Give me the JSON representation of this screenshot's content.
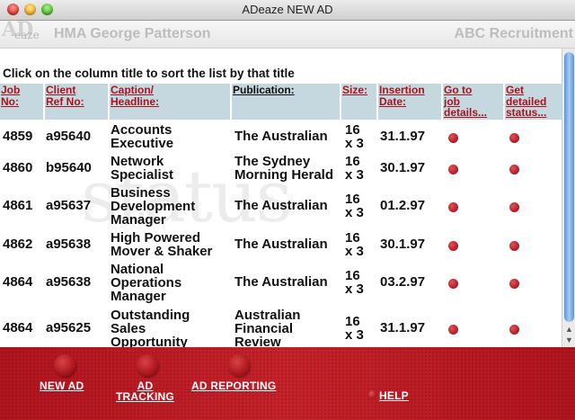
{
  "window": {
    "title": "ADeaze NEW AD"
  },
  "banner": {
    "logo_ad": "AD",
    "logo_rest": "eaze",
    "agency": "HMA George Patterson",
    "company": "ABC Recruitment"
  },
  "watermark": "status",
  "instruction": "Click on the column title to sort the list by that title",
  "columns": {
    "job_no": "Job\nNo:",
    "client_ref": "Client\nRef No:",
    "caption": "Caption/\nHeadline:",
    "publication": "Publication:",
    "size": "Size:",
    "insertion": "Insertion\nDate:",
    "goto": "Go to\njob\ndetails...",
    "status": "Get\ndetailed\nstatus..."
  },
  "rows": [
    {
      "job": "4859",
      "ref": "a95640",
      "caption": "Accounts\nExecutive",
      "pub": "The Australian",
      "size": "16\nx 3",
      "date": "31.1.97"
    },
    {
      "job": "4860",
      "ref": "b95640",
      "caption": "Network\nSpecialist",
      "pub": "The Sydney\nMorning Herald",
      "size": "16\nx 3",
      "date": "30.1.97"
    },
    {
      "job": "4861",
      "ref": "a95637",
      "caption": "Business\nDevelopment\nManager",
      "pub": "The Australian",
      "size": "16\nx 3",
      "date": "01.2.97"
    },
    {
      "job": "4862",
      "ref": "a95638",
      "caption": "High Powered\nMover & Shaker",
      "pub": "The Australian",
      "size": "16\nx 3",
      "date": "30.1.97"
    },
    {
      "job": "4864",
      "ref": "a95638",
      "caption": "National\nOperations\nManager",
      "pub": "The Australian",
      "size": "16\nx 3",
      "date": "03.2.97"
    },
    {
      "job": "4864",
      "ref": "a95625",
      "caption": "Outstanding\nSales\nOpportunity",
      "pub": "Australian\nFinancial\nReview",
      "size": "16\nx 3",
      "date": "31.1.97"
    }
  ],
  "footer": {
    "new_ad": "NEW AD",
    "ad_tracking": "AD\nTRACKING",
    "ad_reporting": "AD REPORTING",
    "help": "HELP"
  }
}
